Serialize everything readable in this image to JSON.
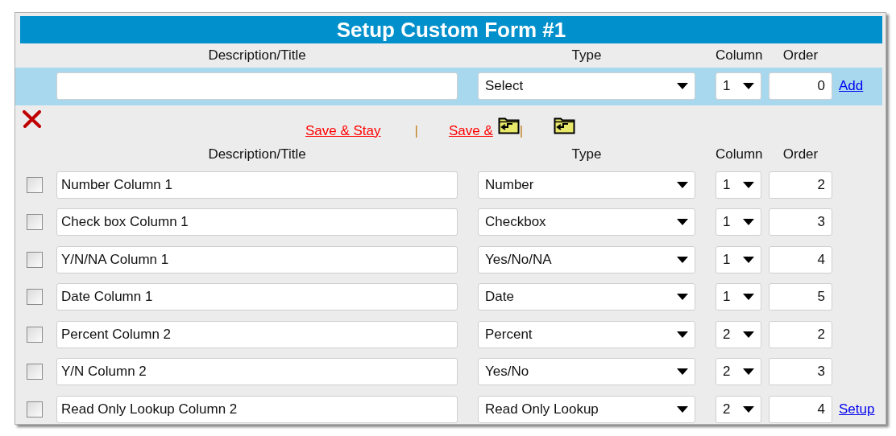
{
  "title": "Setup Custom Form #1",
  "new_field_headers": [
    "Description/Title",
    "Type",
    "Column",
    "Order"
  ],
  "new_field": {
    "type": "Select",
    "column": "1",
    "order": "0",
    "link": "Add"
  },
  "actions": [
    {
      "kind": "link",
      "label": "Save & Stay"
    },
    {
      "kind": "separator",
      "label": "|"
    },
    {
      "kind": "link-icon",
      "label": "Save &"
    },
    {
      "kind": "separator",
      "label": "|"
    },
    {
      "kind": "icon"
    }
  ],
  "field_headers": [
    "Description/Title",
    "Type",
    "Column",
    "Order"
  ],
  "fields": [
    {
      "checked": false,
      "description": "Number Column 1",
      "type": "Number",
      "column": "1",
      "order": "2"
    },
    {
      "checked": false,
      "description": "Check box Column 1",
      "type": "Checkbox",
      "column": "1",
      "order": "3"
    },
    {
      "checked": false,
      "description": "Y/N/NA Column 1",
      "type": "Yes/No/NA",
      "column": "1",
      "order": "4"
    },
    {
      "checked": false,
      "description": "Date Column 1",
      "type": "Date",
      "column": "1",
      "order": "5"
    },
    {
      "checked": false,
      "description": "Percent Column 2",
      "type": "Percent",
      "column": "2",
      "order": "2"
    },
    {
      "checked": false,
      "description": "Y/N Column 2",
      "type": "Yes/No",
      "column": "2",
      "order": "3"
    },
    {
      "checked": false,
      "description": "Read Only Lookup Column 2",
      "type": "Read Only Lookup",
      "column": "2",
      "order": "4",
      "link": "Setup"
    }
  ]
}
